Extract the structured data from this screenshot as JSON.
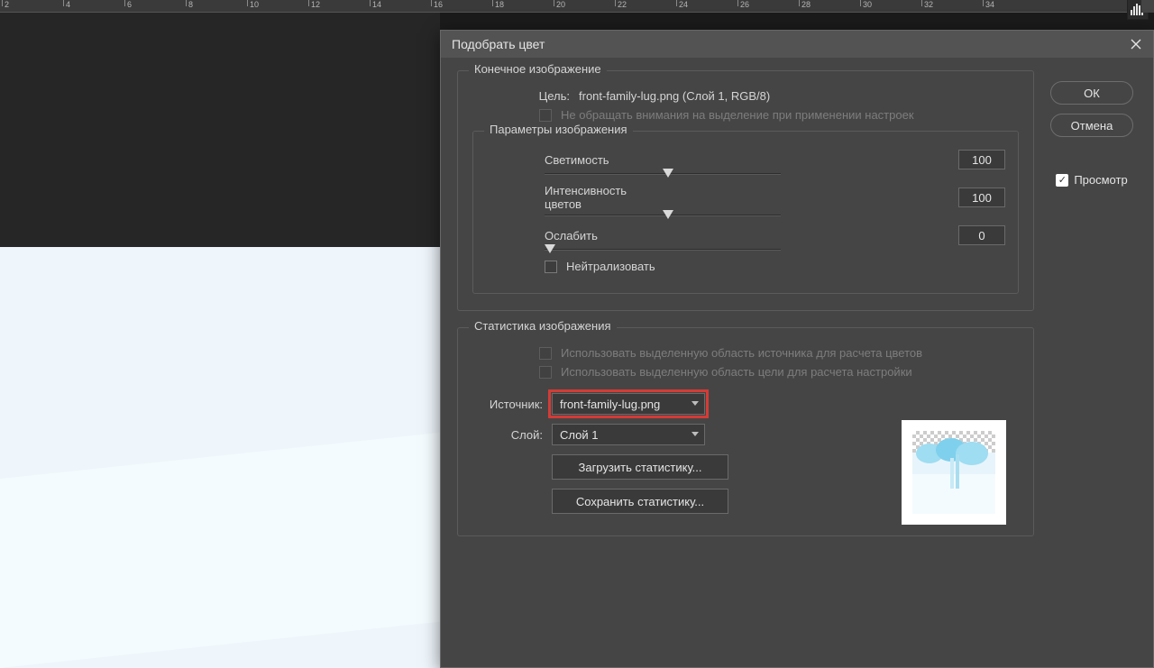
{
  "ruler": {
    "ticks": [
      "2",
      "4",
      "6",
      "8",
      "10",
      "12",
      "14",
      "16",
      "18",
      "20",
      "22",
      "24",
      "26",
      "28",
      "30",
      "32",
      "34"
    ]
  },
  "dialog": {
    "title": "Подобрать цвет",
    "ok": "ОК",
    "cancel": "Отмена",
    "preview_label": "Просмотр"
  },
  "dest": {
    "legend": "Конечное изображение",
    "target_label": "Цель:",
    "target_value": "front-family-lug.png (Слой 1, RGB/8)",
    "ignore_sel": "Не обращать внимания на выделение при применении настроек"
  },
  "params": {
    "legend": "Параметры изображения",
    "luminance_label": "Светимость",
    "luminance_value": "100",
    "intensity_label": "Интенсивность цветов",
    "intensity_value": "100",
    "fade_label": "Ослабить",
    "fade_value": "0",
    "neutralize": "Нейтрализовать"
  },
  "stats": {
    "legend": "Статистика изображения",
    "use_src_sel": "Использовать выделенную область источника для расчета цветов",
    "use_tgt_sel": "Использовать выделенную область цели для расчета настройки",
    "source_label": "Источник:",
    "source_value": "front-family-lug.png",
    "layer_label": "Слой:",
    "layer_value": "Слой 1",
    "load_btn": "Загрузить статистику...",
    "save_btn": "Сохранить статистику..."
  }
}
